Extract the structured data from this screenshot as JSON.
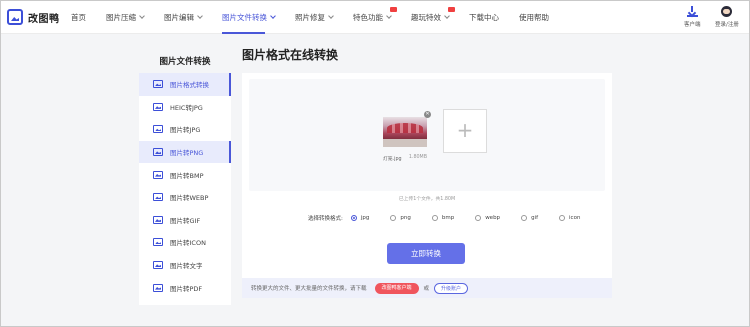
{
  "brand": {
    "name": "改图鸭"
  },
  "nav": {
    "items": [
      {
        "label": "首页",
        "dropdown": false,
        "hot": false,
        "active": false
      },
      {
        "label": "图片压缩",
        "dropdown": true,
        "hot": false,
        "active": false
      },
      {
        "label": "图片编辑",
        "dropdown": true,
        "hot": false,
        "active": false
      },
      {
        "label": "图片文件转换",
        "dropdown": true,
        "hot": false,
        "active": true
      },
      {
        "label": "照片修复",
        "dropdown": true,
        "hot": false,
        "active": false
      },
      {
        "label": "特色功能",
        "dropdown": true,
        "hot": true,
        "active": false
      },
      {
        "label": "趣玩特效",
        "dropdown": true,
        "hot": true,
        "active": false
      },
      {
        "label": "下载中心",
        "dropdown": false,
        "hot": false,
        "active": false
      },
      {
        "label": "使用帮助",
        "dropdown": false,
        "hot": false,
        "active": false
      }
    ],
    "download_label": "客户端",
    "login_label": "登录/注册"
  },
  "sidebar": {
    "title": "图片文件转换",
    "items": [
      {
        "label": "图片格式转换",
        "icon": "image-icon",
        "state": "active"
      },
      {
        "label": "HEIC转JPG",
        "icon": "image-icon",
        "state": ""
      },
      {
        "label": "图片转JPG",
        "icon": "image-icon",
        "state": ""
      },
      {
        "label": "图片转PNG",
        "icon": "image-icon",
        "state": "current"
      },
      {
        "label": "图片转BMP",
        "icon": "image-icon",
        "state": ""
      },
      {
        "label": "图片转WEBP",
        "icon": "image-icon",
        "state": ""
      },
      {
        "label": "图片转GIF",
        "icon": "image-icon",
        "state": ""
      },
      {
        "label": "图片转ICON",
        "icon": "image-icon",
        "state": ""
      },
      {
        "label": "图片转文字",
        "icon": "image-icon",
        "state": ""
      },
      {
        "label": "图片转PDF",
        "icon": "image-icon",
        "state": ""
      }
    ]
  },
  "main": {
    "title": "图片格式在线转换",
    "file": {
      "name": "灯笼.jpg",
      "size": "1.80MB"
    },
    "add_symbol": "+",
    "upload_stat": "已上传1个文件，共1.80M",
    "format_label": "选择转换格式:",
    "formats": [
      {
        "label": "jpg",
        "selected": true
      },
      {
        "label": "png",
        "selected": false
      },
      {
        "label": "bmp",
        "selected": false
      },
      {
        "label": "webp",
        "selected": false
      },
      {
        "label": "gif",
        "selected": false
      },
      {
        "label": "icon",
        "selected": false
      }
    ],
    "convert_label": "立即转换",
    "bottom_text": "转换更大的文件、更大批量的文件转换，请下载",
    "vip_label": "改图鸭客户端",
    "or_text": "或",
    "upgrade_label": "升级账户"
  },
  "colors": {
    "accent": "#4a57d8",
    "button": "#6470e8",
    "vip": "#f0555d"
  }
}
